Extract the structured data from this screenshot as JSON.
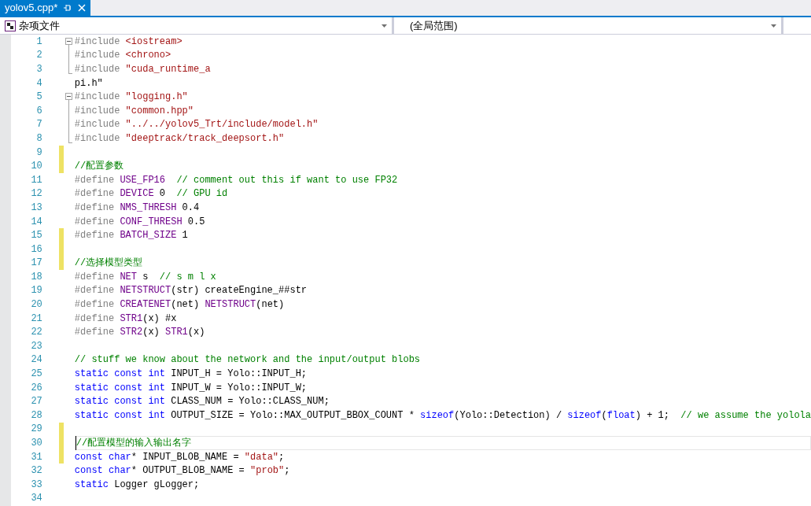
{
  "tab": {
    "title": "yolov5.cpp*",
    "selected": true
  },
  "nav": {
    "scope": "杂项文件",
    "members": "(全局范围)"
  },
  "lines": [
    {
      "number": "1",
      "changed": false,
      "current": false,
      "expanded": true,
      "tokens": [
        {
          "kind": "preproc",
          "text": "#include "
        },
        {
          "kind": "string",
          "text": "<iostream>"
        }
      ],
      "children": [
        {
          "number": "2",
          "changed": false,
          "current": false,
          "tokens": [
            {
              "kind": "preproc",
              "text": "#include "
            },
            {
              "kind": "string",
              "text": "<chrono>"
            }
          ]
        },
        {
          "number": "3",
          "changed": false,
          "current": false,
          "tokens": [
            {
              "kind": "preproc",
              "text": "#include "
            },
            {
              "kind": "string",
              "text": "\"cuda_runtime_a"
            }
          ]
        }
      ]
    },
    {
      "number": "4",
      "changed": false,
      "current": false,
      "tokens": [
        {
          "kind": "plain",
          "text": "pi.h\""
        }
      ]
    },
    {
      "number": "5",
      "changed": false,
      "current": false,
      "expanded": true,
      "tokens": [
        {
          "kind": "preproc",
          "text": "#include "
        },
        {
          "kind": "string",
          "text": "\"logging.h\""
        }
      ],
      "children": [
        {
          "number": "6",
          "changed": false,
          "current": false,
          "tokens": [
            {
              "kind": "preproc",
              "text": "#include "
            },
            {
              "kind": "string",
              "text": "\"common.hpp\""
            }
          ]
        },
        {
          "number": "7",
          "changed": false,
          "current": false,
          "tokens": [
            {
              "kind": "preproc",
              "text": "#include "
            },
            {
              "kind": "string",
              "text": "\"../../yolov5_Trt/include/model.h\""
            }
          ]
        },
        {
          "number": "8",
          "changed": false,
          "current": false,
          "tokens": [
            {
              "kind": "preproc",
              "text": "#include "
            },
            {
              "kind": "string",
              "text": "\"deeptrack/track_deepsort.h\""
            }
          ]
        }
      ]
    },
    {
      "number": "9",
      "changed": true,
      "current": false
    },
    {
      "number": "10",
      "changed": true,
      "current": false,
      "tokens": [
        {
          "kind": "comment",
          "text": "//配置参数"
        }
      ]
    },
    {
      "number": "11",
      "changed": false,
      "current": false,
      "tokens": [
        {
          "kind": "preproc",
          "text": "#define "
        },
        {
          "kind": "macro",
          "text": "USE_FP16"
        },
        {
          "kind": "comment",
          "text": "  // comment out this if want to use FP32"
        }
      ]
    },
    {
      "number": "12",
      "changed": false,
      "current": false,
      "tokens": [
        {
          "kind": "preproc",
          "text": "#define "
        },
        {
          "kind": "macro",
          "text": "DEVICE"
        },
        {
          "kind": "plain",
          "text": " 0  "
        },
        {
          "kind": "comment",
          "text": "// GPU id"
        }
      ]
    },
    {
      "number": "13",
      "changed": false,
      "current": false,
      "tokens": [
        {
          "kind": "preproc",
          "text": "#define "
        },
        {
          "kind": "macro",
          "text": "NMS_THRESH"
        },
        {
          "kind": "plain",
          "text": " 0.4"
        }
      ]
    },
    {
      "number": "14",
      "changed": false,
      "current": false,
      "tokens": [
        {
          "kind": "preproc",
          "text": "#define "
        },
        {
          "kind": "macro",
          "text": "CONF_THRESH"
        },
        {
          "kind": "plain",
          "text": " 0.5"
        }
      ]
    },
    {
      "number": "15",
      "changed": true,
      "current": false,
      "tokens": [
        {
          "kind": "preproc",
          "text": "#define "
        },
        {
          "kind": "macro",
          "text": "BATCH_SIZE"
        },
        {
          "kind": "plain",
          "text": " 1"
        }
      ]
    },
    {
      "number": "16",
      "changed": true,
      "current": false
    },
    {
      "number": "17",
      "changed": true,
      "current": false,
      "tokens": [
        {
          "kind": "comment",
          "text": "//选择模型类型"
        }
      ]
    },
    {
      "number": "18",
      "changed": false,
      "current": false,
      "tokens": [
        {
          "kind": "preproc",
          "text": "#define "
        },
        {
          "kind": "macro",
          "text": "NET"
        },
        {
          "kind": "plain",
          "text": " s  "
        },
        {
          "kind": "comment",
          "text": "// s m l x"
        }
      ]
    },
    {
      "number": "19",
      "changed": false,
      "current": false,
      "tokens": [
        {
          "kind": "preproc",
          "text": "#define "
        },
        {
          "kind": "macro",
          "text": "NETSTRUCT"
        },
        {
          "kind": "plain",
          "text": "(str) createEngine_##str"
        }
      ]
    },
    {
      "number": "20",
      "changed": false,
      "current": false,
      "tokens": [
        {
          "kind": "preproc",
          "text": "#define "
        },
        {
          "kind": "macro",
          "text": "CREATENET"
        },
        {
          "kind": "plain",
          "text": "(net) "
        },
        {
          "kind": "macro",
          "text": "NETSTRUCT"
        },
        {
          "kind": "plain",
          "text": "(net)"
        }
      ]
    },
    {
      "number": "21",
      "changed": false,
      "current": false,
      "tokens": [
        {
          "kind": "preproc",
          "text": "#define "
        },
        {
          "kind": "macro",
          "text": "STR1"
        },
        {
          "kind": "plain",
          "text": "(x) #x"
        }
      ]
    },
    {
      "number": "22",
      "changed": false,
      "current": false,
      "tokens": [
        {
          "kind": "preproc",
          "text": "#define "
        },
        {
          "kind": "macro",
          "text": "STR2"
        },
        {
          "kind": "plain",
          "text": "(x) "
        },
        {
          "kind": "macro",
          "text": "STR1"
        },
        {
          "kind": "plain",
          "text": "(x)"
        }
      ]
    },
    {
      "number": "23",
      "changed": false,
      "current": false
    },
    {
      "number": "24",
      "changed": false,
      "current": false,
      "tokens": [
        {
          "kind": "comment",
          "text": "// stuff we know about the network and the input/output blobs"
        }
      ]
    },
    {
      "number": "25",
      "changed": false,
      "current": false,
      "tokens": [
        {
          "kind": "keyword",
          "text": "static const int"
        },
        {
          "kind": "plain",
          "text": " INPUT_H = Yolo::INPUT_H;"
        }
      ]
    },
    {
      "number": "26",
      "changed": false,
      "current": false,
      "tokens": [
        {
          "kind": "keyword",
          "text": "static const int"
        },
        {
          "kind": "plain",
          "text": " INPUT_W = Yolo::INPUT_W;"
        }
      ]
    },
    {
      "number": "27",
      "changed": false,
      "current": false,
      "tokens": [
        {
          "kind": "keyword",
          "text": "static const int"
        },
        {
          "kind": "plain",
          "text": " CLASS_NUM = Yolo::CLASS_NUM;"
        }
      ]
    },
    {
      "number": "28",
      "changed": false,
      "current": false,
      "tokens": [
        {
          "kind": "keyword",
          "text": "static const int"
        },
        {
          "kind": "plain",
          "text": " OUTPUT_SIZE = Yolo::MAX_OUTPUT_BBOX_COUNT * "
        },
        {
          "kind": "keyword",
          "text": "sizeof"
        },
        {
          "kind": "plain",
          "text": "(Yolo::Detection) / "
        },
        {
          "kind": "keyword",
          "text": "sizeof"
        },
        {
          "kind": "plain",
          "text": "("
        },
        {
          "kind": "keyword",
          "text": "float"
        },
        {
          "kind": "plain",
          "text": ") + 1;  "
        },
        {
          "kind": "comment",
          "text": "// we assume the yolola"
        }
      ]
    },
    {
      "number": "29",
      "changed": true,
      "current": false
    },
    {
      "number": "30",
      "changed": true,
      "current": true,
      "tokens": [
        {
          "kind": "comment",
          "text": "//配置模型的输入输出名字"
        }
      ]
    },
    {
      "number": "31",
      "changed": true,
      "current": false,
      "tokens": [
        {
          "kind": "keyword",
          "text": "const char"
        },
        {
          "kind": "plain",
          "text": "* INPUT_BLOB_NAME = "
        },
        {
          "kind": "string",
          "text": "\"data\""
        },
        {
          "kind": "plain",
          "text": ";"
        }
      ]
    },
    {
      "number": "32",
      "changed": false,
      "current": false,
      "tokens": [
        {
          "kind": "keyword",
          "text": "const char"
        },
        {
          "kind": "plain",
          "text": "* OUTPUT_BLOB_NAME = "
        },
        {
          "kind": "string",
          "text": "\"prob\""
        },
        {
          "kind": "plain",
          "text": ";"
        }
      ]
    },
    {
      "number": "33",
      "changed": false,
      "current": false,
      "tokens": [
        {
          "kind": "keyword",
          "text": "static"
        },
        {
          "kind": "plain",
          "text": " Logger gLogger;"
        }
      ]
    },
    {
      "number": "34",
      "changed": false,
      "current": false
    }
  ]
}
